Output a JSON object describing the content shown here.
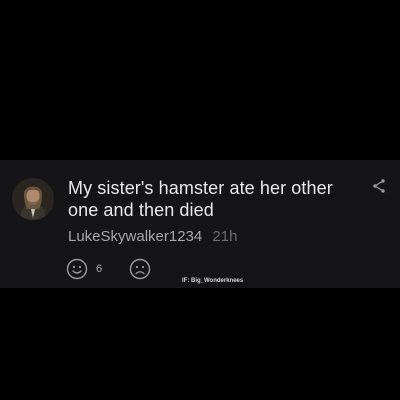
{
  "post": {
    "text": "My sister's hamster ate her other one and then died",
    "username": "LukeSkywalker1234",
    "time": "21h",
    "reactions": {
      "like_count": "6"
    }
  },
  "watermark": "IF: Big_Wonderknees",
  "icons": {
    "share": "share-icon",
    "like": "smile-face-icon",
    "dislike": "frown-face-icon",
    "avatar": "user-avatar"
  },
  "colors": {
    "page_background": "#000000",
    "card_background": "#151517",
    "text_primary": "#e9e9ea",
    "text_secondary": "#a8a8ac",
    "text_muted": "#6d6d72",
    "icon": "#9b9ba0"
  }
}
